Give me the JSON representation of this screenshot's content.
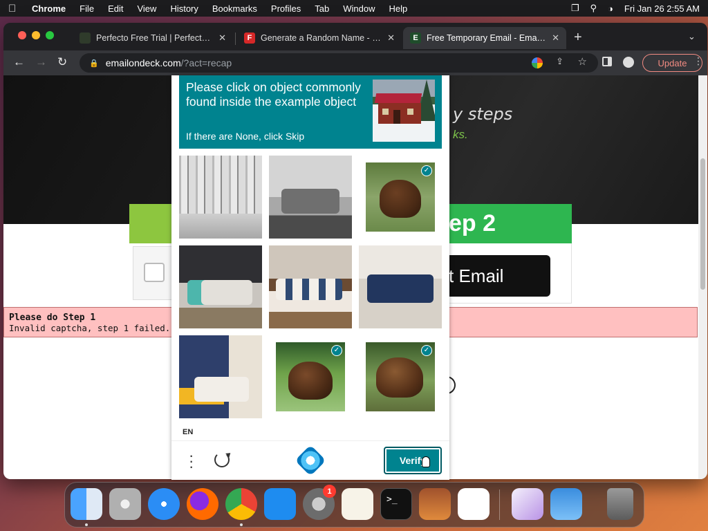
{
  "menubar": {
    "app_name": "Chrome",
    "menus": [
      "File",
      "Edit",
      "View",
      "History",
      "Bookmarks",
      "Profiles",
      "Tab",
      "Window",
      "Help"
    ],
    "clock": "Fri Jan 26  2:55 AM"
  },
  "tabs": [
    {
      "title": "Perfecto Free Trial | Perfecto by",
      "favicon_color": "#2f3b2b",
      "favicon_text": "",
      "active": false
    },
    {
      "title": "Generate a Random Name - Ra",
      "favicon_color": "#d62828",
      "favicon_text": "F",
      "active": false
    },
    {
      "title": "Free Temporary Email - EmailO",
      "favicon_color": "#1f4d2b",
      "favicon_text": "E",
      "active": true
    }
  ],
  "address_bar": {
    "host": "emailondeck.com",
    "path": "/?act=recap"
  },
  "toolbar": {
    "update_label": "Update"
  },
  "page": {
    "hero_text": "y steps",
    "hero_sub": "ks.",
    "step2_label": "ep 2",
    "get_email_label": "t Email",
    "error_title": "Please do Step 1",
    "error_message": "Invalid captcha, step 1 failed."
  },
  "captcha": {
    "prompt": "Please click on object commonly found inside the example object",
    "hint": "If there are None, click Skip",
    "language": "EN",
    "verify_label": "Verify",
    "cells": [
      {
        "name": "captcha-cell-forest",
        "selected": false
      },
      {
        "name": "captcha-cell-gray-sofa",
        "selected": false
      },
      {
        "name": "captcha-cell-bear",
        "selected": true
      },
      {
        "name": "captcha-cell-living-room-dark",
        "selected": false
      },
      {
        "name": "captcha-cell-living-room-brown",
        "selected": false
      },
      {
        "name": "captcha-cell-blue-sofa",
        "selected": false
      },
      {
        "name": "captcha-cell-blue-wall-room",
        "selected": false
      },
      {
        "name": "captcha-cell-bear-forest",
        "selected": true
      },
      {
        "name": "captcha-cell-bear-log",
        "selected": true
      }
    ]
  },
  "dock": {
    "apps": [
      "finder-icon",
      "launchpad-icon",
      "safari-icon",
      "firefox-icon",
      "chrome-icon",
      "app-store-icon",
      "system-settings-icon",
      "textedit-icon",
      "terminal-icon",
      "garageband-icon",
      "vscode-icon",
      "visual-studio-icon",
      "weather-icon",
      "trash-icon"
    ],
    "settings_badge": "1"
  }
}
